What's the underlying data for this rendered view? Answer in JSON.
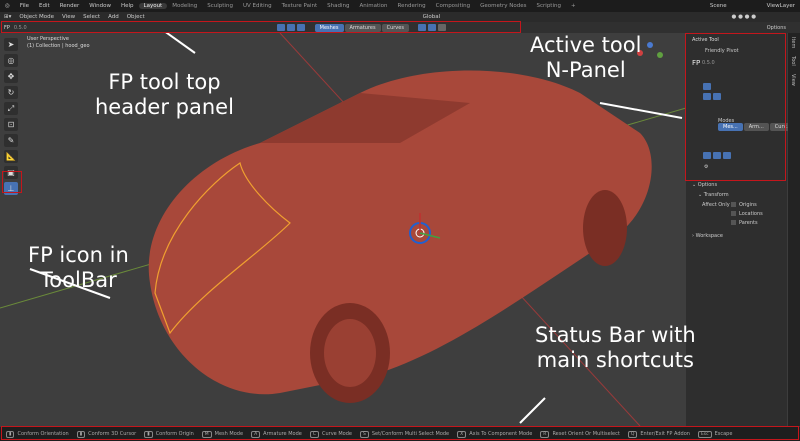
{
  "menu": [
    "File",
    "Edit",
    "Render",
    "Window",
    "Help"
  ],
  "workspaces": [
    "Layout",
    "Modeling",
    "Sculpting",
    "UV Editing",
    "Texture Paint",
    "Shading",
    "Animation",
    "Rendering",
    "Compositing",
    "Geometry Nodes",
    "Scripting",
    "+"
  ],
  "scene": "Scene",
  "view_layer": "ViewLayer",
  "header": {
    "mode": "Object Mode",
    "items": [
      "View",
      "Select",
      "Add",
      "Object"
    ],
    "orientation": "Global",
    "options": "Options"
  },
  "fp_header": {
    "label": "FP",
    "version": "0.5.0",
    "modes": [
      "Meshes",
      "Armatures",
      "Curves"
    ]
  },
  "viewport": {
    "perspective": "User Perspective",
    "collection": "(1) Collection | hood_geo"
  },
  "npanel": {
    "active_tool": "Active Tool",
    "tool_name": "Friendly Pivot",
    "fp_label": "FP",
    "version": "0.5.0",
    "modes_label": "Modes",
    "modes": [
      "Mes...",
      "Arm...",
      "Curv..."
    ],
    "options": "Options",
    "transform": "Transform",
    "affect_only": "Affect Only",
    "checks": [
      "Origins",
      "Locations",
      "Parents"
    ],
    "workspace": "Workspace",
    "tabs": [
      "Item",
      "Tool",
      "View"
    ]
  },
  "status": [
    {
      "key": "",
      "label": "Conform Orientation"
    },
    {
      "key": "",
      "label": "Conform 3D Cursor"
    },
    {
      "key": "",
      "label": "Conform Origin"
    },
    {
      "key": "M",
      "label": "Mesh Mode"
    },
    {
      "key": "A",
      "label": "Armature Mode"
    },
    {
      "key": "C",
      "label": "Curve Mode"
    },
    {
      "key": "S",
      "label": "Set/Conform Multi Select Mode"
    },
    {
      "key": "X",
      "label": "Axis To Component Mode"
    },
    {
      "key": "R",
      "label": "Reset Orient Or Multiselect"
    },
    {
      "key": "Q",
      "label": "Enter/Exit FP Addon"
    },
    {
      "key": "Esc",
      "label": "Escape"
    }
  ],
  "annotations": {
    "top": "FP tool top\nheader panel",
    "npanel": "Active tool\nN-Panel",
    "toolbar": "FP icon in\nToolBar",
    "status": "Status Bar with\nmain shortcuts"
  },
  "colors": {
    "highlight": "#c4161c",
    "accent": "#4772b3",
    "car": "#a8483a"
  }
}
